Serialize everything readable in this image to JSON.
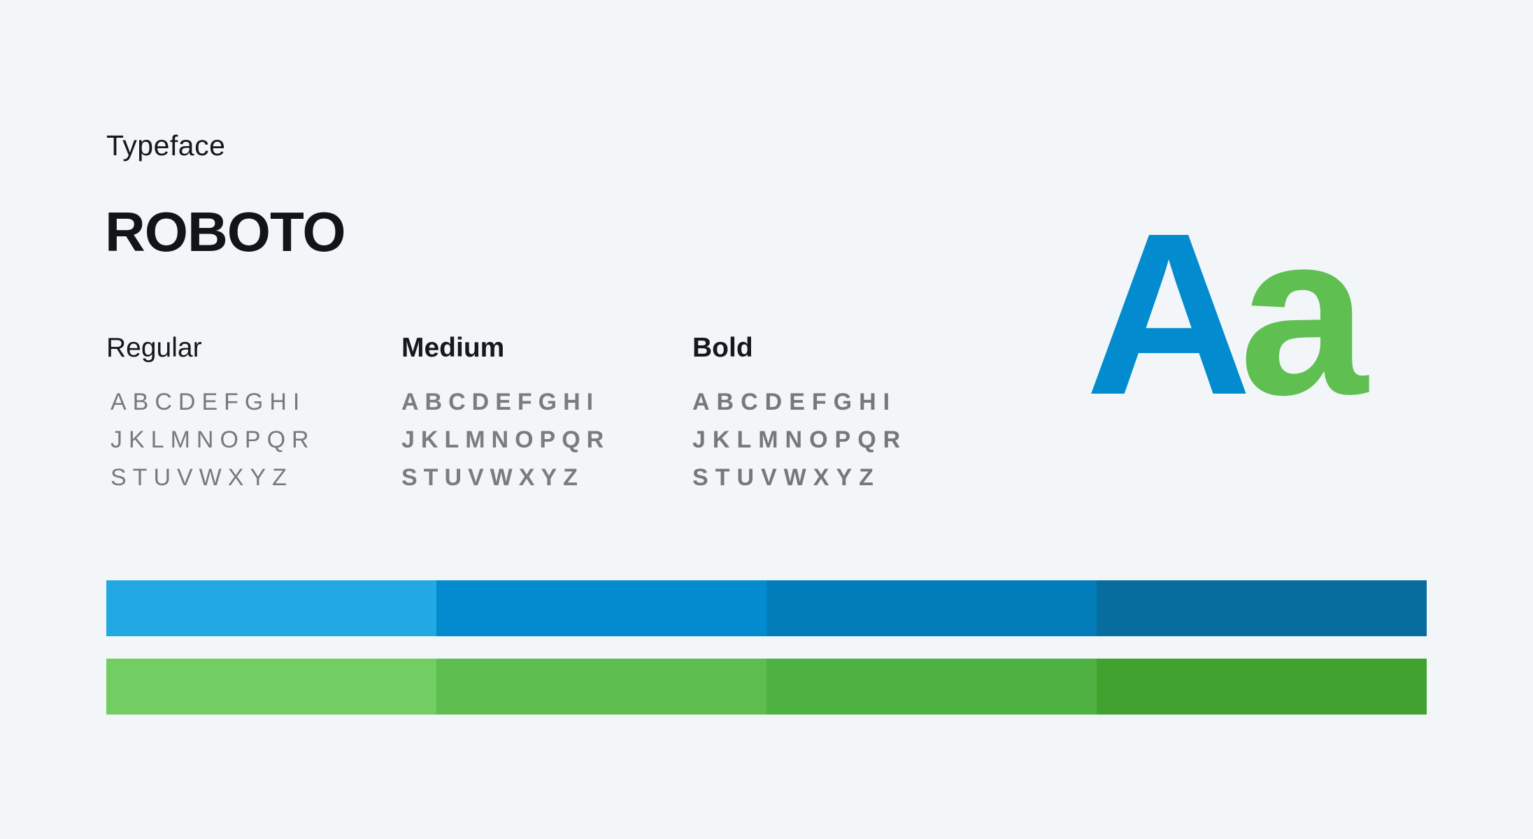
{
  "header": {
    "label": "Typeface",
    "font_name": "ROBOTO"
  },
  "weights": [
    {
      "name": "Regular",
      "lines": [
        "ABCDEFGHI",
        "JKLMNOPQR",
        "STUVWXYZ"
      ]
    },
    {
      "name": "Medium",
      "lines": [
        "ABCDEFGHI",
        "JKLMNOPQR",
        "STUVWXYZ"
      ]
    },
    {
      "name": "Bold",
      "lines": [
        "ABCDEFGHI",
        "JKLMNOPQR",
        "STUVWXYZ"
      ]
    }
  ],
  "sample": {
    "upper": "A",
    "lower": "a",
    "upper_color": "#028ccf",
    "lower_color": "#5fbf51"
  },
  "palettes": {
    "blue": [
      "#22a9e3",
      "#028ccf",
      "#027dba",
      "#066d9e"
    ],
    "green": [
      "#72cd63",
      "#5dbe4f",
      "#50b143",
      "#41a22f"
    ]
  }
}
